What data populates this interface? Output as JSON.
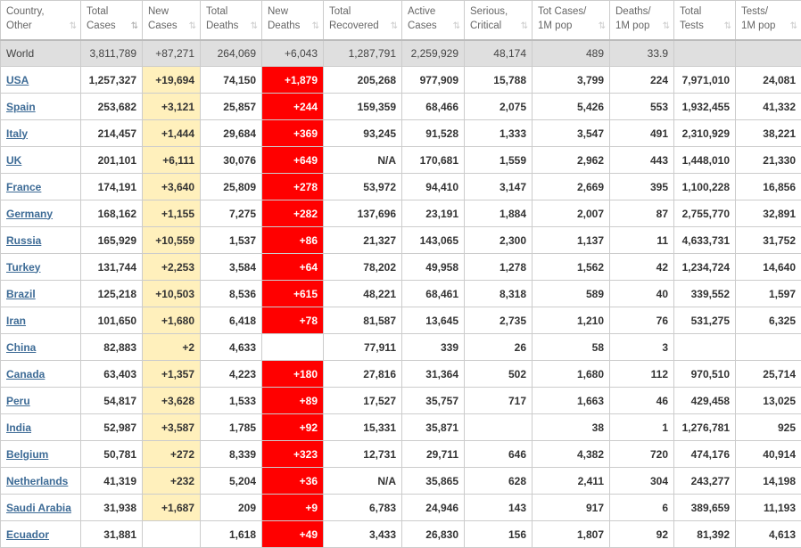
{
  "headers": [
    {
      "line1": "Country,",
      "line2": "Other",
      "sorted": false
    },
    {
      "line1": "Total",
      "line2": "Cases",
      "sorted": true
    },
    {
      "line1": "New",
      "line2": "Cases",
      "sorted": false
    },
    {
      "line1": "Total",
      "line2": "Deaths",
      "sorted": false
    },
    {
      "line1": "New",
      "line2": "Deaths",
      "sorted": false
    },
    {
      "line1": "Total",
      "line2": "Recovered",
      "sorted": false
    },
    {
      "line1": "Active",
      "line2": "Cases",
      "sorted": false
    },
    {
      "line1": "Serious,",
      "line2": "Critical",
      "sorted": false
    },
    {
      "line1": "Tot Cases/",
      "line2": "1M pop",
      "sorted": false
    },
    {
      "line1": "Deaths/",
      "line2": "1M pop",
      "sorted": false
    },
    {
      "line1": "Total",
      "line2": "Tests",
      "sorted": false
    },
    {
      "line1": "Tests/",
      "line2": "1M pop",
      "sorted": false
    }
  ],
  "sort_icon": "⇅",
  "world": [
    "World",
    "3,811,789",
    "+87,271",
    "264,069",
    "+6,043",
    "1,287,791",
    "2,259,929",
    "48,174",
    "489",
    "33.9",
    "",
    ""
  ],
  "rows": [
    [
      "USA",
      "1,257,327",
      "+19,694",
      "74,150",
      "+1,879",
      "205,268",
      "977,909",
      "15,788",
      "3,799",
      "224",
      "7,971,010",
      "24,081"
    ],
    [
      "Spain",
      "253,682",
      "+3,121",
      "25,857",
      "+244",
      "159,359",
      "68,466",
      "2,075",
      "5,426",
      "553",
      "1,932,455",
      "41,332"
    ],
    [
      "Italy",
      "214,457",
      "+1,444",
      "29,684",
      "+369",
      "93,245",
      "91,528",
      "1,333",
      "3,547",
      "491",
      "2,310,929",
      "38,221"
    ],
    [
      "UK",
      "201,101",
      "+6,111",
      "30,076",
      "+649",
      "N/A",
      "170,681",
      "1,559",
      "2,962",
      "443",
      "1,448,010",
      "21,330"
    ],
    [
      "France",
      "174,191",
      "+3,640",
      "25,809",
      "+278",
      "53,972",
      "94,410",
      "3,147",
      "2,669",
      "395",
      "1,100,228",
      "16,856"
    ],
    [
      "Germany",
      "168,162",
      "+1,155",
      "7,275",
      "+282",
      "137,696",
      "23,191",
      "1,884",
      "2,007",
      "87",
      "2,755,770",
      "32,891"
    ],
    [
      "Russia",
      "165,929",
      "+10,559",
      "1,537",
      "+86",
      "21,327",
      "143,065",
      "2,300",
      "1,137",
      "11",
      "4,633,731",
      "31,752"
    ],
    [
      "Turkey",
      "131,744",
      "+2,253",
      "3,584",
      "+64",
      "78,202",
      "49,958",
      "1,278",
      "1,562",
      "42",
      "1,234,724",
      "14,640"
    ],
    [
      "Brazil",
      "125,218",
      "+10,503",
      "8,536",
      "+615",
      "48,221",
      "68,461",
      "8,318",
      "589",
      "40",
      "339,552",
      "1,597"
    ],
    [
      "Iran",
      "101,650",
      "+1,680",
      "6,418",
      "+78",
      "81,587",
      "13,645",
      "2,735",
      "1,210",
      "76",
      "531,275",
      "6,325"
    ],
    [
      "China",
      "82,883",
      "+2",
      "4,633",
      "",
      "77,911",
      "339",
      "26",
      "58",
      "3",
      "",
      ""
    ],
    [
      "Canada",
      "63,403",
      "+1,357",
      "4,223",
      "+180",
      "27,816",
      "31,364",
      "502",
      "1,680",
      "112",
      "970,510",
      "25,714"
    ],
    [
      "Peru",
      "54,817",
      "+3,628",
      "1,533",
      "+89",
      "17,527",
      "35,757",
      "717",
      "1,663",
      "46",
      "429,458",
      "13,025"
    ],
    [
      "India",
      "52,987",
      "+3,587",
      "1,785",
      "+92",
      "15,331",
      "35,871",
      "",
      "38",
      "1",
      "1,276,781",
      "925"
    ],
    [
      "Belgium",
      "50,781",
      "+272",
      "8,339",
      "+323",
      "12,731",
      "29,711",
      "646",
      "4,382",
      "720",
      "474,176",
      "40,914"
    ],
    [
      "Netherlands",
      "41,319",
      "+232",
      "5,204",
      "+36",
      "N/A",
      "35,865",
      "628",
      "2,411",
      "304",
      "243,277",
      "14,198"
    ],
    [
      "Saudi Arabia",
      "31,938",
      "+1,687",
      "209",
      "+9",
      "6,783",
      "24,946",
      "143",
      "917",
      "6",
      "389,659",
      "11,193"
    ],
    [
      "Ecuador",
      "31,881",
      "",
      "1,618",
      "+49",
      "3,433",
      "26,830",
      "156",
      "1,807",
      "92",
      "81,392",
      "4,613"
    ]
  ]
}
